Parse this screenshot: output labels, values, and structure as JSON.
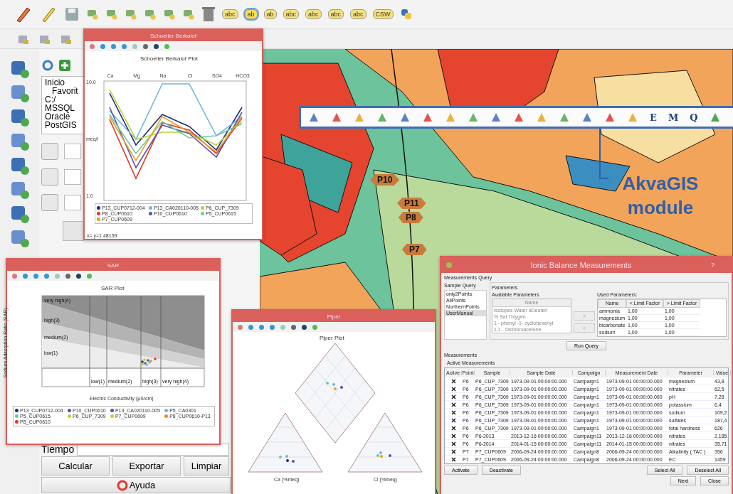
{
  "main_toolbar": {
    "label_tools": [
      {
        "text": "abc",
        "selected": false
      },
      {
        "text": "ab",
        "selected": true
      },
      {
        "text": "ab",
        "selected": false
      },
      {
        "text": "abc",
        "selected": false
      },
      {
        "text": "abc",
        "selected": false
      },
      {
        "text": "abc",
        "selected": false
      },
      {
        "text": "abc",
        "selected": false
      },
      {
        "text": "CSW",
        "selected": false
      }
    ]
  },
  "browser": {
    "items": [
      {
        "label": "Inicio",
        "children": [
          {
            "label": "Favorit"
          }
        ]
      },
      {
        "label": "C:/"
      },
      {
        "label": "MSSQL"
      },
      {
        "label": "Oracle"
      },
      {
        "label": "PostGIS"
      }
    ]
  },
  "tool_panel": {
    "time_label": "Tiempo",
    "actions": [
      "Calcular",
      "Exportar",
      "Limpiar"
    ],
    "help": "Ayuda"
  },
  "map": {
    "points": [
      {
        "label": "P10"
      },
      {
        "label": "P11"
      },
      {
        "label": "P8"
      },
      {
        "label": "P7"
      }
    ],
    "toolbar_letters": [
      "E",
      "M",
      "Q"
    ],
    "callout": "AkvaGIS module"
  },
  "schoeller": {
    "title": "Schoeller Berkalof",
    "plot_title": "Schoeller Berkalof Plot",
    "categories": [
      "Ca",
      "Mg",
      "Na",
      "Cl",
      "SO4",
      "HCO3"
    ],
    "ylabel": "meq/l",
    "yticks": [
      "10.0",
      "1.0"
    ],
    "legend": [
      {
        "name": "P13_CUP0712-004",
        "color": "#1f2a7a"
      },
      {
        "name": "P13_CA020110-005",
        "color": "#6fb7e0"
      },
      {
        "name": "P6_CUP_7309",
        "color": "#b5d334"
      },
      {
        "name": "P8_CUP0610",
        "color": "#e0362c"
      },
      {
        "name": "P10_CUP0610",
        "color": "#5b4fb0"
      },
      {
        "name": "P5_CUP0615",
        "color": "#6cc9a0"
      },
      {
        "name": "P7_CUP0609",
        "color": "#e6a21f"
      }
    ],
    "status": "x= y=1.48159"
  },
  "sar": {
    "title": "SAR",
    "plot_title": "SAR Plot",
    "ylabel": "Sodium Adsorption Ratio (SAR)",
    "xlabel": "Electric Conductivity (μS/cm)",
    "zones_y": [
      "very high(4)",
      "high(3)",
      "medium(2)",
      "low(1)"
    ],
    "zones_x": [
      "low(1)",
      "medium(2)",
      "high(3)",
      "very high(4)"
    ],
    "legend": [
      {
        "name": "P13_CUP0712-004",
        "color": "#1f2a7a"
      },
      {
        "name": "P10_CUP0610",
        "color": "#5b4fb0"
      },
      {
        "name": "P13_CA020110-005",
        "color": "#3d5fb8"
      },
      {
        "name": "P5_CA0301",
        "color": "#6fb7e0"
      },
      {
        "name": "P5_CUP0615",
        "color": "#6cc9a0"
      },
      {
        "name": "P6_CUP_7309",
        "color": "#b5d334"
      },
      {
        "name": "P7_CUP0609",
        "color": "#e6c21f"
      },
      {
        "name": "P8_CUP0610-P13",
        "color": "#f08a24"
      },
      {
        "name": "P8_CUP0610",
        "color": "#e0362c"
      }
    ]
  },
  "piper": {
    "title": "Piper",
    "plot_title": "Piper Plot",
    "left_xlabel": "Ca (%meq)",
    "right_xlabel": "Cl (%meq)"
  },
  "ionic": {
    "title": "Ionic Balance Measurements",
    "help": "?",
    "query_group": "Measurements Query",
    "sample_query_label": "Sample Query",
    "queries": [
      {
        "label": "only2Points",
        "selected": false
      },
      {
        "label": "AllPoints",
        "selected": false
      },
      {
        "label": "NorthernPoints",
        "selected": false
      },
      {
        "label": "UserManual",
        "selected": true
      }
    ],
    "parameters_label": "Parameters",
    "available_label": "Available Parameters",
    "available_header": "Name",
    "available": [
      "Isotopes Water dDeuteri",
      "%  Sat Oxygen",
      "1 - phenyl -1- cyclohexenyl",
      "1,1 - Dichloroacetone"
    ],
    "move_buttons": [
      ">",
      "<"
    ],
    "used_label": "Used Parameters:",
    "used_columns": [
      "Name",
      "< Limit Factor",
      "> Limit Factor"
    ],
    "used": [
      [
        "ammonia",
        "1,00",
        "1,00"
      ],
      [
        "magnesium",
        "1,00",
        "1,00"
      ],
      [
        "bicarbonate",
        "1,00",
        "1,00"
      ],
      [
        "sodium",
        "1,00",
        "1,00"
      ]
    ],
    "run_query": "Run Query",
    "measurements_group": "Measurements",
    "active_label": "Active Measurements",
    "active_column": "Active",
    "columns": [
      "Point",
      "Sample",
      "Sample Date",
      "Campaign",
      "Measurement Date",
      "Parameter",
      "Value"
    ],
    "rows": [
      {
        "active": true,
        "cells": [
          "P6",
          "P6_CUP_7309",
          "1973-09-01 00:00:00.000",
          "Campaign1",
          "1973-09-01 00:00:00.000",
          "magnesium",
          "43,8"
        ]
      },
      {
        "active": true,
        "cells": [
          "P6",
          "P6_CUP_7309",
          "1973-09-01 00:00:00.000",
          "Campaign1",
          "1973-09-01 00:00:00.000",
          "nitrates",
          "62,5"
        ]
      },
      {
        "active": true,
        "cells": [
          "P6",
          "P6_CUP_7309",
          "1973-09-01 00:00:00.000",
          "Campaign1",
          "1973-09-01 00:00:00.000",
          "pH",
          "7,28"
        ]
      },
      {
        "active": true,
        "cells": [
          "P6",
          "P6_CUP_7309",
          "1973-09-01 00:00:00.000",
          "Campaign1",
          "1973-09-01 00:00:00.000",
          "potassium",
          "6,4"
        ]
      },
      {
        "active": true,
        "cells": [
          "P6",
          "P6_CUP_7309",
          "1973-09-01 00:00:00.000",
          "Campaign1",
          "1973-09-01 00:00:00.000",
          "sodium",
          "109,2"
        ]
      },
      {
        "active": true,
        "cells": [
          "P6",
          "P6_CUP_7309",
          "1973-09-01 00:00:00.000",
          "Campaign1",
          "1973-09-01 00:00:00.000",
          "sulfates",
          "187,4"
        ]
      },
      {
        "active": true,
        "cells": [
          "P6",
          "P6_CUP_7309",
          "1973-09-01 00:00:00.000",
          "Campaign1",
          "1973-09-01 00:00:00.000",
          "total hardness",
          "626"
        ]
      },
      {
        "active": true,
        "cells": [
          "P6",
          "P6-2013",
          "2013-12-16 00:00:00.000",
          "Campaign11",
          "2013-12-16 00:00:00.000",
          "nitrates",
          "2,185"
        ]
      },
      {
        "active": true,
        "cells": [
          "P6",
          "P6-2014",
          "2014-01-15 00:00:00.000",
          "Campaign11",
          "2014-01-15 00:00:00.000",
          "nitrates",
          "35,71"
        ]
      },
      {
        "active": true,
        "cells": [
          "P7",
          "P7_CUP0609",
          "2006-09-24 00:00:00.000",
          "Campaign8",
          "2006-09-24 00:00:00.000",
          "Alkalinity ( TAC )",
          "356"
        ]
      },
      {
        "active": true,
        "cells": [
          "P7",
          "P7_CUP0609",
          "2006-09-24 00:00:00.000",
          "Campaign8",
          "2006-09-24 00:00:00.000",
          "EC",
          "1459"
        ]
      }
    ],
    "left_buttons": [
      "Activate",
      "Deactivate"
    ],
    "right_buttons": [
      "Select All",
      "Deselect All"
    ],
    "bottom_buttons": [
      "Next",
      "Close"
    ]
  }
}
